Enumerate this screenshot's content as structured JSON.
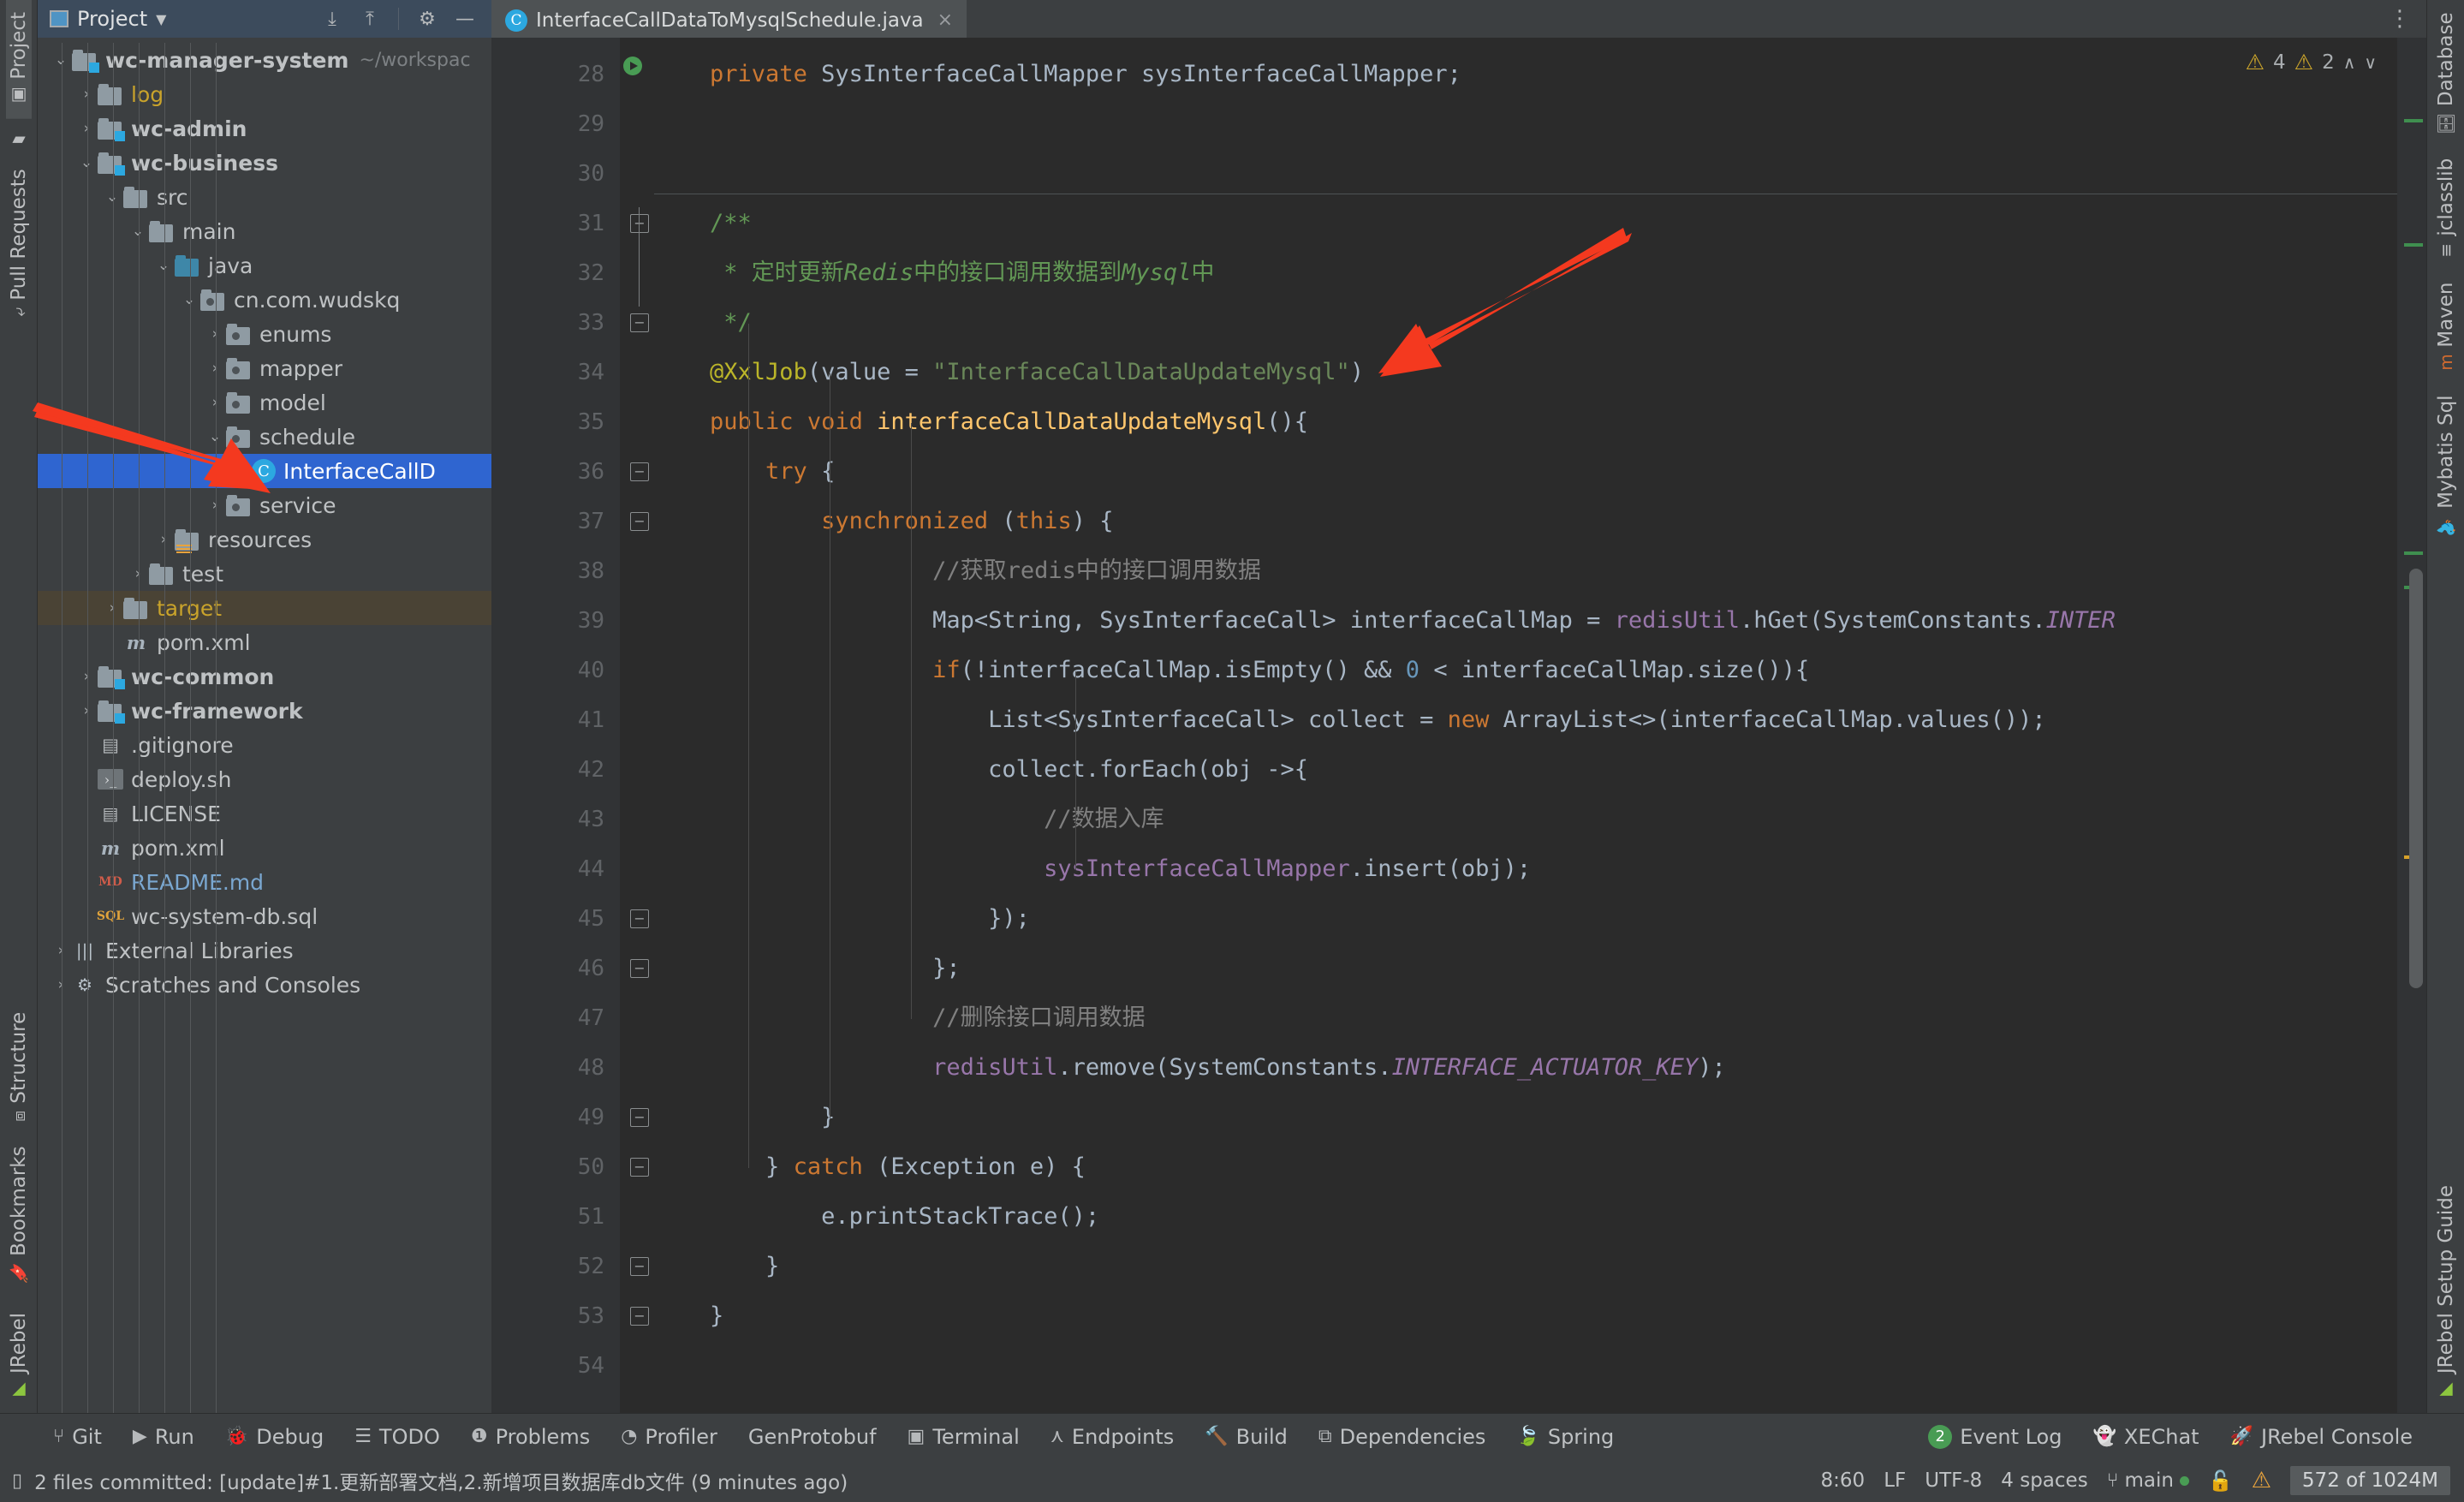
{
  "window": {
    "left_strip": [
      {
        "label": "Project",
        "icon": "project-icon",
        "selected": true
      },
      {
        "label": "",
        "icon": "folder-icon",
        "selected": false
      },
      {
        "label": "Pull Requests",
        "icon": "pull-request-icon",
        "selected": false
      },
      {
        "label": "Structure",
        "icon": "structure-icon",
        "selected": false
      },
      {
        "label": "Bookmarks",
        "icon": "bookmark-icon",
        "selected": false
      },
      {
        "label": "JRebel",
        "icon": "jrebel-icon",
        "selected": false
      }
    ],
    "right_strip": [
      {
        "label": "Database",
        "icon": "database-icon"
      },
      {
        "label": "jclasslib",
        "icon": "jclasslib-icon"
      },
      {
        "label": "Maven",
        "icon": "maven-icon"
      },
      {
        "label": "Mybatis Sql",
        "icon": "mybatis-icon"
      },
      {
        "label": "JRebel Setup Guide",
        "icon": "jrebel-guide-icon"
      }
    ]
  },
  "project_panel": {
    "title": "Project",
    "toolbar_buttons": [
      {
        "name": "collapse-all",
        "glyph": "⤓"
      },
      {
        "name": "expand-all",
        "glyph": "⤒"
      },
      {
        "name": "settings-gear",
        "glyph": "⚙"
      },
      {
        "name": "hide-panel",
        "glyph": "—"
      }
    ],
    "tree": [
      {
        "depth": 0,
        "label": "wc-manager-system",
        "suffix": "~/workspac",
        "arrow": "down",
        "icon": "module-folder",
        "bold": true
      },
      {
        "depth": 1,
        "label": "log",
        "arrow": "right",
        "icon": "folder",
        "color": "yellow"
      },
      {
        "depth": 1,
        "label": "wc-admin",
        "arrow": "right",
        "icon": "module-folder",
        "bold": true
      },
      {
        "depth": 1,
        "label": "wc-business",
        "arrow": "down",
        "icon": "module-folder",
        "bold": true
      },
      {
        "depth": 2,
        "label": "src",
        "arrow": "down",
        "icon": "folder"
      },
      {
        "depth": 3,
        "label": "main",
        "arrow": "down",
        "icon": "folder"
      },
      {
        "depth": 4,
        "label": "java",
        "arrow": "down",
        "icon": "source-folder"
      },
      {
        "depth": 5,
        "label": "cn.com.wudskq",
        "arrow": "down",
        "icon": "package"
      },
      {
        "depth": 6,
        "label": "enums",
        "arrow": "right",
        "icon": "package"
      },
      {
        "depth": 6,
        "label": "mapper",
        "arrow": "right",
        "icon": "package"
      },
      {
        "depth": 6,
        "label": "model",
        "arrow": "right",
        "icon": "package"
      },
      {
        "depth": 6,
        "label": "schedule",
        "arrow": "down",
        "icon": "package"
      },
      {
        "depth": 7,
        "label": "InterfaceCallD",
        "arrow": "none",
        "icon": "java-class",
        "selected": true
      },
      {
        "depth": 6,
        "label": "service",
        "arrow": "right",
        "icon": "package"
      },
      {
        "depth": 4,
        "label": "resources",
        "arrow": "right",
        "icon": "resources-folder"
      },
      {
        "depth": 3,
        "label": "test",
        "arrow": "right",
        "icon": "folder"
      },
      {
        "depth": 2,
        "label": "target",
        "arrow": "right",
        "icon": "folder",
        "color": "yellow",
        "row_highlight": true
      },
      {
        "depth": 2,
        "label": "pom.xml",
        "arrow": "none",
        "icon": "maven-file"
      },
      {
        "depth": 1,
        "label": "wc-common",
        "arrow": "right",
        "icon": "module-folder",
        "bold": true
      },
      {
        "depth": 1,
        "label": "wc-framework",
        "arrow": "right",
        "icon": "module-folder",
        "bold": true
      },
      {
        "depth": 1,
        "label": ".gitignore",
        "arrow": "none",
        "icon": "git-file"
      },
      {
        "depth": 1,
        "label": "deploy.sh",
        "arrow": "none",
        "icon": "shell-file"
      },
      {
        "depth": 1,
        "label": "LICENSE",
        "arrow": "none",
        "icon": "text-file"
      },
      {
        "depth": 1,
        "label": "pom.xml",
        "arrow": "none",
        "icon": "maven-file"
      },
      {
        "depth": 1,
        "label": "README.md",
        "arrow": "none",
        "icon": "markdown-file",
        "color": "blue"
      },
      {
        "depth": 1,
        "label": "wc-system-db.sql",
        "arrow": "none",
        "icon": "sql-file"
      },
      {
        "depth": 0,
        "label": "External Libraries",
        "arrow": "right",
        "icon": "library"
      },
      {
        "depth": 0,
        "label": "Scratches and Consoles",
        "arrow": "right",
        "icon": "scratch"
      }
    ]
  },
  "editor": {
    "tab": {
      "label": "InterfaceCallDataToMysqlSchedule.java",
      "icon": "java-class-icon",
      "close": "×"
    },
    "options_glyph": "⋮",
    "inspections": {
      "warning_count": "4",
      "weak_warning_count": "2",
      "up": "∧",
      "down": "∨"
    },
    "first_line_number": 28,
    "lines": [
      {
        "n": 28,
        "tokens": [
          {
            "t": "    ",
            "c": ""
          },
          {
            "t": "private",
            "c": "kw"
          },
          {
            "t": " SysInterfaceCallMapper sysInterfaceCallMapper;",
            "c": "typ"
          }
        ]
      },
      {
        "n": 29,
        "tokens": []
      },
      {
        "n": 30,
        "tokens": []
      },
      {
        "n": 31,
        "tokens": [
          {
            "t": "    /**",
            "c": "doc"
          }
        ]
      },
      {
        "n": 32,
        "tokens": [
          {
            "t": "     * ",
            "c": "doc"
          },
          {
            "t": "定时更新",
            "c": "doc"
          },
          {
            "t": "Redis",
            "c": "doci"
          },
          {
            "t": "中的接口调用数据到",
            "c": "doc"
          },
          {
            "t": "Mysql",
            "c": "doci"
          },
          {
            "t": "中",
            "c": "doc"
          }
        ]
      },
      {
        "n": 33,
        "tokens": [
          {
            "t": "     */",
            "c": "doc"
          }
        ]
      },
      {
        "n": 34,
        "tokens": [
          {
            "t": "    ",
            "c": ""
          },
          {
            "t": "@XxlJob",
            "c": "ann"
          },
          {
            "t": "(",
            "c": "br1"
          },
          {
            "t": "value",
            "c": "typ"
          },
          {
            "t": " = ",
            "c": "br1"
          },
          {
            "t": "\"InterfaceCallDataUpdateMysql\"",
            "c": "str"
          },
          {
            "t": ")",
            "c": "br1"
          }
        ]
      },
      {
        "n": 35,
        "tokens": [
          {
            "t": "    ",
            "c": ""
          },
          {
            "t": "public",
            "c": "kw"
          },
          {
            "t": " ",
            "c": ""
          },
          {
            "t": "void",
            "c": "kw"
          },
          {
            "t": " ",
            "c": ""
          },
          {
            "t": "interfaceCallDataUpdateMysql",
            "c": "fn"
          },
          {
            "t": "(){",
            "c": "br1"
          }
        ]
      },
      {
        "n": 36,
        "tokens": [
          {
            "t": "        ",
            "c": ""
          },
          {
            "t": "try",
            "c": "kw"
          },
          {
            "t": " {",
            "c": "br1"
          }
        ]
      },
      {
        "n": 37,
        "tokens": [
          {
            "t": "            ",
            "c": ""
          },
          {
            "t": "synchronized",
            "c": "kw"
          },
          {
            "t": " (",
            "c": "br1"
          },
          {
            "t": "this",
            "c": "kw"
          },
          {
            "t": ") {",
            "c": "br1"
          }
        ]
      },
      {
        "n": 38,
        "tokens": [
          {
            "t": "                    //获取redis中的接口调用数据",
            "c": "cmt"
          }
        ]
      },
      {
        "n": 39,
        "tokens": [
          {
            "t": "                    Map",
            "c": "typ"
          },
          {
            "t": "<",
            "c": "br1"
          },
          {
            "t": "String",
            "c": "typ"
          },
          {
            "t": ", ",
            "c": "br1"
          },
          {
            "t": "SysInterfaceCall",
            "c": "typ"
          },
          {
            "t": "> interfaceCallMap = ",
            "c": "typ"
          },
          {
            "t": "redisUtil",
            "c": "fld"
          },
          {
            "t": ".hGet(SystemConstants.",
            "c": "typ"
          },
          {
            "t": "INTER",
            "c": "stc"
          }
        ]
      },
      {
        "n": 40,
        "tokens": [
          {
            "t": "                    ",
            "c": ""
          },
          {
            "t": "if",
            "c": "kw"
          },
          {
            "t": "(!interfaceCallMap.isEmpty() && ",
            "c": "typ"
          },
          {
            "t": "0",
            "c": "num"
          },
          {
            "t": " < interfaceCallMap.size()){",
            "c": "typ"
          }
        ]
      },
      {
        "n": 41,
        "tokens": [
          {
            "t": "                        List",
            "c": "typ"
          },
          {
            "t": "<",
            "c": "br1"
          },
          {
            "t": "SysInterfaceCall",
            "c": "typ"
          },
          {
            "t": "> collect = ",
            "c": "typ"
          },
          {
            "t": "new",
            "c": "kw"
          },
          {
            "t": " ArrayList<>(interfaceCallMap.values());",
            "c": "typ"
          }
        ]
      },
      {
        "n": 42,
        "tokens": [
          {
            "t": "                        collect.forEach(obj ->{",
            "c": "typ"
          }
        ]
      },
      {
        "n": 43,
        "tokens": [
          {
            "t": "                            //数据入库",
            "c": "cmt"
          }
        ]
      },
      {
        "n": 44,
        "tokens": [
          {
            "t": "                            ",
            "c": ""
          },
          {
            "t": "sysInterfaceCallMapper",
            "c": "fld"
          },
          {
            "t": ".insert(obj);",
            "c": "typ"
          }
        ]
      },
      {
        "n": 45,
        "tokens": [
          {
            "t": "                        });",
            "c": "typ"
          }
        ]
      },
      {
        "n": 46,
        "tokens": [
          {
            "t": "                    };",
            "c": "typ"
          }
        ]
      },
      {
        "n": 47,
        "tokens": [
          {
            "t": "                    //删除接口调用数据",
            "c": "cmt"
          }
        ]
      },
      {
        "n": 48,
        "tokens": [
          {
            "t": "                    ",
            "c": ""
          },
          {
            "t": "redisUtil",
            "c": "fld"
          },
          {
            "t": ".remove(SystemConstants.",
            "c": "typ"
          },
          {
            "t": "INTERFACE_ACTUATOR_KEY",
            "c": "stc"
          },
          {
            "t": ");",
            "c": "typ"
          }
        ]
      },
      {
        "n": 49,
        "tokens": [
          {
            "t": "            }",
            "c": "typ"
          }
        ]
      },
      {
        "n": 50,
        "tokens": [
          {
            "t": "        } ",
            "c": "typ"
          },
          {
            "t": "catch",
            "c": "kw"
          },
          {
            "t": " (Exception e) {",
            "c": "typ"
          }
        ]
      },
      {
        "n": 51,
        "tokens": [
          {
            "t": "            e.printStackTrace();",
            "c": "typ"
          }
        ]
      },
      {
        "n": 52,
        "tokens": [
          {
            "t": "        }",
            "c": "typ"
          }
        ]
      },
      {
        "n": 53,
        "tokens": [
          {
            "t": "    }",
            "c": "typ"
          }
        ]
      },
      {
        "n": 54,
        "tokens": []
      }
    ]
  },
  "bottom_toolbar": {
    "left_items": [
      {
        "label": "Git",
        "icon": "git-icon"
      },
      {
        "label": "Run",
        "icon": "run-icon"
      },
      {
        "label": "Debug",
        "icon": "debug-icon"
      },
      {
        "label": "TODO",
        "icon": "todo-icon"
      },
      {
        "label": "Problems",
        "icon": "problems-icon"
      },
      {
        "label": "Profiler",
        "icon": "profiler-icon"
      },
      {
        "label": "GenProtobuf",
        "icon": "genprotobuf-icon"
      },
      {
        "label": "Terminal",
        "icon": "terminal-icon"
      },
      {
        "label": "Endpoints",
        "icon": "endpoints-icon"
      },
      {
        "label": "Build",
        "icon": "build-icon"
      },
      {
        "label": "Dependencies",
        "icon": "dependencies-icon"
      },
      {
        "label": "Spring",
        "icon": "spring-icon"
      }
    ],
    "right_items": [
      {
        "label": "Event Log",
        "icon": "event-log-icon",
        "badge": "2"
      },
      {
        "label": "XEChat",
        "icon": "xechat-icon"
      },
      {
        "label": "JRebel Console",
        "icon": "jrebel-console-icon"
      }
    ]
  },
  "status_bar": {
    "message": "2 files committed: [update]#1.更新部署文档,2.新增项目数据库db文件 (9 minutes ago)",
    "caret_position": "8:60",
    "line_separator": "LF",
    "encoding": "UTF-8",
    "indent": "4 spaces",
    "branch": "main",
    "memory": "572 of 1024M"
  },
  "annotations": {
    "arrow_color": "#f4391f",
    "arrow_1_target": "schedule-package",
    "arrow_2_target": "xxljob-annotation-line"
  }
}
